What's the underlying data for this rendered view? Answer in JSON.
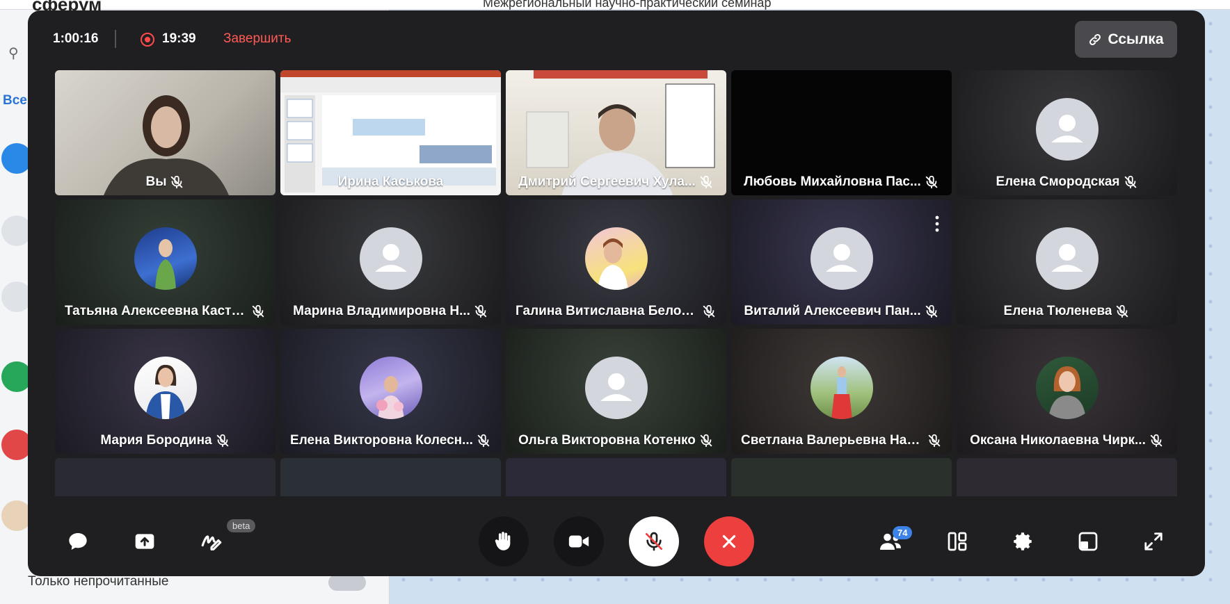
{
  "background": {
    "logo": "сферум",
    "chat_title": "Межрегиональный научно-практический семинар",
    "tab_label": "Все",
    "unread_label": "Только непрочитанные"
  },
  "call": {
    "duration": "1:00:16",
    "recording_time": "19:39",
    "finish_label": "Завершить",
    "link_label": "Ссылка"
  },
  "participants": [
    {
      "name": "Вы",
      "type": "video",
      "muted": true
    },
    {
      "name": "Ирина Каськова",
      "type": "screen",
      "muted": false
    },
    {
      "name": "Дмитрий Сергеевич Хула...",
      "type": "video",
      "muted": true
    },
    {
      "name": "Любовь Михайловна Пас...",
      "type": "black",
      "muted": true
    },
    {
      "name": "Елена Смородская",
      "type": "placeholder",
      "muted": true
    },
    {
      "name": "Татьяна Алексеевна Кастр...",
      "type": "photo",
      "muted": true
    },
    {
      "name": "Марина Владимировна Н...",
      "type": "placeholder",
      "muted": true
    },
    {
      "name": "Галина Витиславна Белол...",
      "type": "photo",
      "muted": true
    },
    {
      "name": "Виталий Алексеевич Пан...",
      "type": "placeholder",
      "muted": true,
      "menu": true
    },
    {
      "name": "Елена Тюленева",
      "type": "placeholder",
      "muted": true
    },
    {
      "name": "Мария Бородина",
      "type": "photo",
      "muted": true
    },
    {
      "name": "Елена Викторовна Колесн...",
      "type": "photo",
      "muted": true
    },
    {
      "name": "Ольга Викторовна Котенко",
      "type": "placeholder",
      "muted": true
    },
    {
      "name": "Светлана Валерьевна Нау...",
      "type": "photo",
      "muted": true
    },
    {
      "name": "Оксана Николаевна Чирк...",
      "type": "photo",
      "muted": true
    }
  ],
  "toolbar": {
    "beta_label": "beta",
    "participants_count": "74"
  },
  "colors": {
    "record": "#ff4b4b",
    "finish": "#ff5a55",
    "hangup": "#ee3f3f",
    "badge": "#3d82e6"
  }
}
